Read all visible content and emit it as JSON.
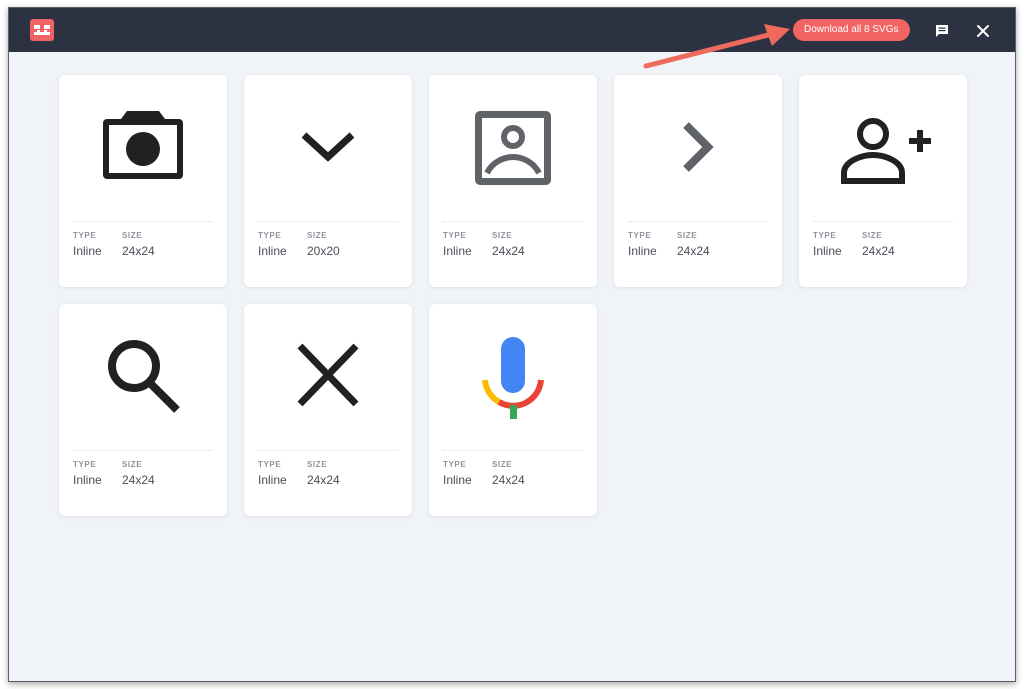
{
  "header": {
    "download_label": "Download all 8 SVGs",
    "accent_color": "#f26363",
    "bar_color": "#2c3242",
    "logo_icon": "svg-gobbler-logo-icon",
    "feedback_icon": "feedback-icon",
    "close_icon": "close-icon"
  },
  "meta_labels": {
    "type": "TYPE",
    "size": "SIZE"
  },
  "cards": [
    {
      "icon": "camera-icon",
      "type": "Inline",
      "size": "24x24"
    },
    {
      "icon": "chevron-down-icon",
      "type": "Inline",
      "size": "20x20"
    },
    {
      "icon": "portrait-icon",
      "type": "Inline",
      "size": "24x24"
    },
    {
      "icon": "chevron-right-icon",
      "type": "Inline",
      "size": "24x24"
    },
    {
      "icon": "add-person-icon",
      "type": "Inline",
      "size": "24x24"
    },
    {
      "icon": "search-icon",
      "type": "Inline",
      "size": "24x24"
    },
    {
      "icon": "close-x-icon",
      "type": "Inline",
      "size": "24x24"
    },
    {
      "icon": "google-mic-icon",
      "type": "Inline",
      "size": "24x24"
    }
  ]
}
